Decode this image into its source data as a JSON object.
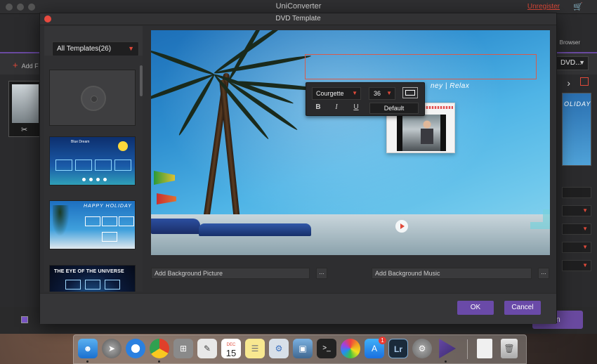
{
  "app": {
    "title": "UniConverter",
    "unregister": "Unregister",
    "add_files": "Add F",
    "browser": "Browser",
    "dvd_select": "DVD...",
    "holiday_text": "OLIDAY",
    "convert": "rn"
  },
  "modal": {
    "title": "DVD Template",
    "template_filter": "All Templates(26)",
    "templates": [
      {
        "name": "blank"
      },
      {
        "name": "Blue Dream",
        "label": "Blue Dream"
      },
      {
        "name": "Happy Holiday",
        "label": "HAPPY HOLIDAY"
      },
      {
        "name": "The Eye of the Universe",
        "label": "THE EYE OF THE UNIVERSE"
      }
    ],
    "preview": {
      "subtitle": "ney  |  Relax"
    },
    "font_toolbar": {
      "font": "Courgette",
      "size": "36",
      "bold": "B",
      "italic": "I",
      "underline": "U",
      "default": "Default"
    },
    "background_picture_placeholder": "Add Background Picture",
    "background_music_placeholder": "Add Background Music",
    "browse_label": "...",
    "ok": "OK",
    "cancel": "Cancel"
  },
  "dock": {
    "calendar_month": "DEC",
    "calendar_day": "15",
    "appstore_badge": "1",
    "lightroom": "Lr",
    "terminal": ">_",
    "items": [
      "finder",
      "launchpad",
      "safari",
      "chrome",
      "calculator",
      "textedit",
      "calendar",
      "notes",
      "preview",
      "photos-editor",
      "terminal",
      "photos",
      "app-store",
      "lightroom",
      "system-preferences",
      "uniconverter",
      "documents",
      "trash"
    ]
  },
  "colors": {
    "accent": "#6a4aa8",
    "danger": "#e04a3a"
  }
}
